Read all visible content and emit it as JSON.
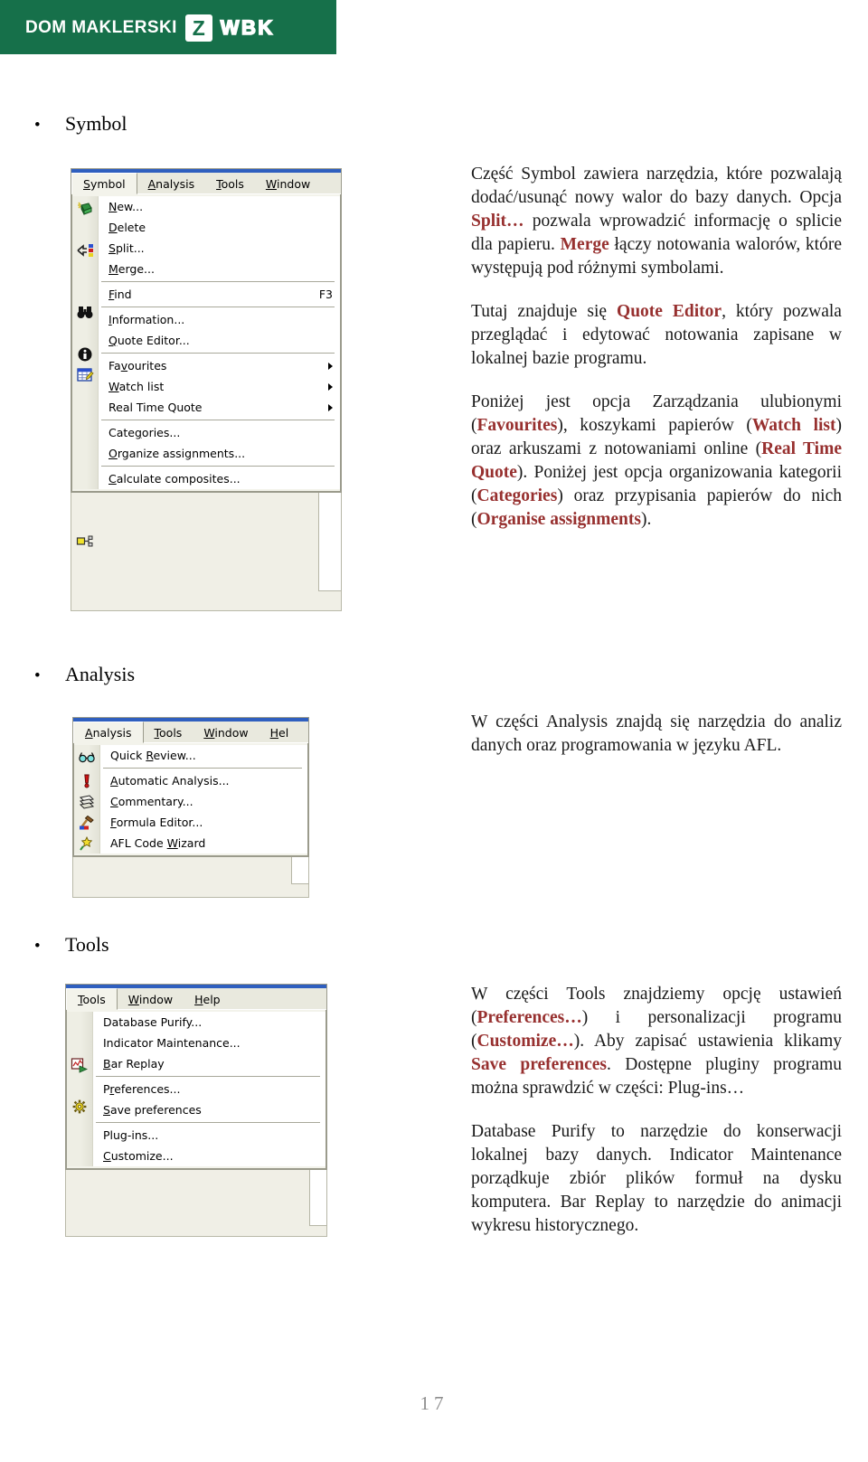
{
  "header": {
    "brand_left": "DOM MAKLERSKI",
    "brand_mark": "Z",
    "brand_right": "WBK",
    "band_color": "#16704a"
  },
  "accent_color": "#97302f",
  "sections": [
    {
      "bullet": "•",
      "title": "Symbol"
    },
    {
      "bullet": "•",
      "title": "Analysis"
    },
    {
      "bullet": "•",
      "title": "Tools"
    }
  ],
  "symbol_menu": {
    "menubar": [
      {
        "label": "Symbol",
        "mnemonic": "S",
        "active": true
      },
      {
        "label": "Analysis",
        "mnemonic": "A",
        "active": false
      },
      {
        "label": "Tools",
        "mnemonic": "T",
        "active": false
      },
      {
        "label": "Window",
        "mnemonic": "W",
        "active": false
      }
    ],
    "items": [
      {
        "label": "New...",
        "mnemonic": "N",
        "icon": "new-symbol-icon",
        "accel": "",
        "arrow": false,
        "sep_after": false
      },
      {
        "label": "Delete",
        "mnemonic": "D",
        "icon": "",
        "accel": "",
        "arrow": false,
        "sep_after": false
      },
      {
        "label": "Split...",
        "mnemonic": "S",
        "icon": "split-icon",
        "accel": "",
        "arrow": false,
        "sep_after": false
      },
      {
        "label": "Merge...",
        "mnemonic": "M",
        "icon": "",
        "accel": "",
        "arrow": false,
        "sep_after": true
      },
      {
        "label": "Find",
        "mnemonic": "F",
        "icon": "binoculars-icon",
        "accel": "F3",
        "arrow": false,
        "sep_after": true
      },
      {
        "label": "Information...",
        "mnemonic": "I",
        "icon": "info-icon",
        "accel": "",
        "arrow": false,
        "sep_after": false
      },
      {
        "label": "Quote Editor...",
        "mnemonic": "Q",
        "icon": "quote-editor-icon",
        "accel": "",
        "arrow": false,
        "sep_after": true
      },
      {
        "label": "Favourites",
        "mnemonic": "v",
        "icon": "",
        "accel": "",
        "arrow": true,
        "sep_after": false
      },
      {
        "label": "Watch list",
        "mnemonic": "W",
        "icon": "",
        "accel": "",
        "arrow": true,
        "sep_after": false
      },
      {
        "label": "Real Time Quote",
        "mnemonic": "",
        "icon": "",
        "accel": "",
        "arrow": true,
        "sep_after": true
      },
      {
        "label": "Categories...",
        "mnemonic": "g",
        "icon": "",
        "accel": "",
        "arrow": false,
        "sep_after": false
      },
      {
        "label": "Organize assignments...",
        "mnemonic": "O",
        "icon": "assignments-icon",
        "accel": "",
        "arrow": false,
        "sep_after": true
      },
      {
        "label": "Calculate composites...",
        "mnemonic": "C",
        "icon": "",
        "accel": "",
        "arrow": false,
        "sep_after": false
      }
    ]
  },
  "analysis_menu": {
    "menubar": [
      {
        "label": "Analysis",
        "mnemonic": "A",
        "active": true
      },
      {
        "label": "Tools",
        "mnemonic": "T",
        "active": false
      },
      {
        "label": "Window",
        "mnemonic": "W",
        "active": false
      },
      {
        "label": "Hel",
        "mnemonic": "H",
        "active": false
      }
    ],
    "items": [
      {
        "label": "Quick Review...",
        "mnemonic": "R",
        "icon": "glasses-icon",
        "accel": "",
        "arrow": false,
        "sep_after": true
      },
      {
        "label": "Automatic Analysis...",
        "mnemonic": "A",
        "icon": "exclamation-icon",
        "accel": "",
        "arrow": false,
        "sep_after": false
      },
      {
        "label": "Commentary...",
        "mnemonic": "C",
        "icon": "commentary-icon",
        "accel": "",
        "arrow": false,
        "sep_after": false
      },
      {
        "label": "Formula Editor...",
        "mnemonic": "F",
        "icon": "hammer-icon",
        "accel": "",
        "arrow": false,
        "sep_after": false
      },
      {
        "label": "AFL Code Wizard",
        "mnemonic": "W",
        "icon": "wizard-icon",
        "accel": "",
        "arrow": false,
        "sep_after": false
      }
    ]
  },
  "tools_menu": {
    "menubar": [
      {
        "label": "Tools",
        "mnemonic": "T",
        "active": true
      },
      {
        "label": "Window",
        "mnemonic": "W",
        "active": false
      },
      {
        "label": "Help",
        "mnemonic": "H",
        "active": false
      }
    ],
    "items": [
      {
        "label": "Database Purify...",
        "mnemonic": "",
        "icon": "",
        "accel": "",
        "arrow": false,
        "sep_after": false
      },
      {
        "label": "Indicator Maintenance...",
        "mnemonic": "",
        "icon": "",
        "accel": "",
        "arrow": false,
        "sep_after": false
      },
      {
        "label": "Bar Replay",
        "mnemonic": "B",
        "icon": "bar-replay-icon",
        "accel": "",
        "arrow": false,
        "sep_after": true
      },
      {
        "label": "Preferences...",
        "mnemonic": "r",
        "icon": "preferences-icon",
        "accel": "",
        "arrow": false,
        "sep_after": false
      },
      {
        "label": "Save preferences",
        "mnemonic": "S",
        "icon": "",
        "accel": "",
        "arrow": false,
        "sep_after": true
      },
      {
        "label": "Plug-ins...",
        "mnemonic": "",
        "icon": "",
        "accel": "",
        "arrow": false,
        "sep_after": false
      },
      {
        "label": "Customize...",
        "mnemonic": "C",
        "icon": "",
        "accel": "",
        "arrow": false,
        "sep_after": false
      }
    ]
  },
  "copy": {
    "symbol": [
      [
        {
          "t": "Część Symbol zawiera narzędzia, które pozwalają dodać/usunąć nowy walor do bazy danych. Opcja ",
          "b": false
        },
        {
          "t": "Split…",
          "b": true
        },
        {
          "t": " pozwala wprowadzić informację o splicie dla papieru. ",
          "b": false
        },
        {
          "t": "Merge",
          "b": true
        },
        {
          "t": " łączy notowania walorów, które występują pod różnymi symbolami.",
          "b": false
        }
      ],
      [
        {
          "t": "Tutaj znajduje się ",
          "b": false
        },
        {
          "t": "Quote Editor",
          "b": true
        },
        {
          "t": ", który pozwala przeglądać i edytować notowania zapisane w lokalnej bazie programu.",
          "b": false
        }
      ],
      [
        {
          "t": "Poniżej jest opcja Zarządzania ulubionymi (",
          "b": false
        },
        {
          "t": "Favourites",
          "b": true
        },
        {
          "t": "), koszykami papierów (",
          "b": false
        },
        {
          "t": "Watch list",
          "b": true
        },
        {
          "t": ") oraz arkuszami z notowaniami online (",
          "b": false
        },
        {
          "t": "Real Time Quote",
          "b": true
        },
        {
          "t": "). Poniżej jest opcja organizowania kategorii (",
          "b": false
        },
        {
          "t": "Categories",
          "b": true
        },
        {
          "t": ") oraz przypisania papierów do nich (",
          "b": false
        },
        {
          "t": "Organise assignments",
          "b": true
        },
        {
          "t": ").",
          "b": false
        }
      ]
    ],
    "analysis": [
      [
        {
          "t": "W części Analysis znajdą się narzędzia do analiz danych oraz programowania w języku AFL.",
          "b": false
        }
      ]
    ],
    "tools": [
      [
        {
          "t": "W części Tools znajdziemy opcję ustawień (",
          "b": false
        },
        {
          "t": "Preferences…",
          "b": true
        },
        {
          "t": ") i personalizacji programu (",
          "b": false
        },
        {
          "t": "Customize…",
          "b": true
        },
        {
          "t": "). Aby zapisać ustawienia klikamy ",
          "b": false
        },
        {
          "t": "Save preferences",
          "b": true
        },
        {
          "t": ". Dostępne pluginy programu można sprawdzić w części: Plug-ins…",
          "b": false
        }
      ],
      [
        {
          "t": "Database Purify to narzędzie do konserwacji lokalnej bazy danych. Indicator Maintenance porządkuje zbiór plików formuł na dysku komputera. Bar Replay to narzędzie do animacji wykresu historycznego.",
          "b": false
        }
      ]
    ]
  },
  "page_number": "17"
}
